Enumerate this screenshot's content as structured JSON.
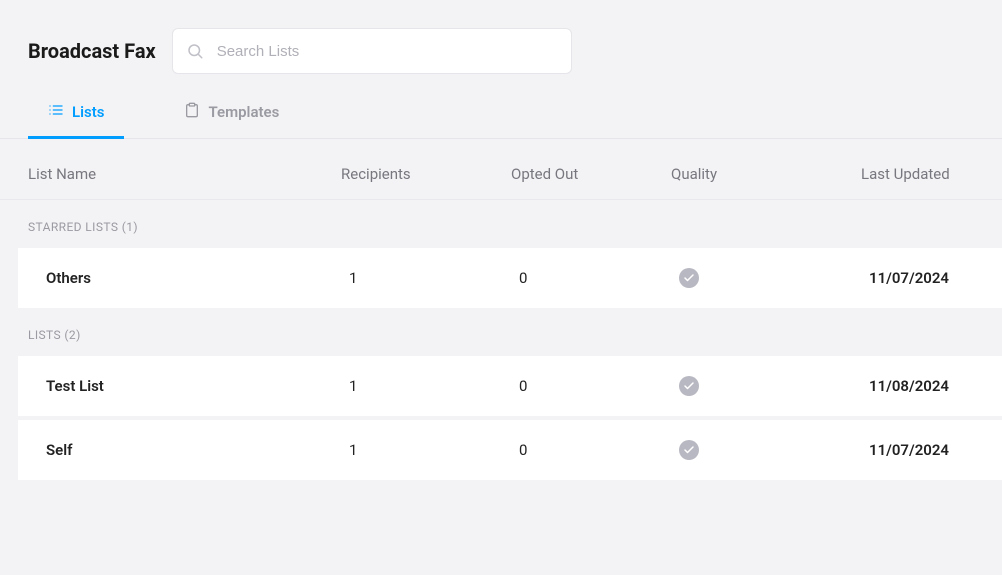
{
  "header": {
    "title": "Broadcast Fax",
    "search_placeholder": "Search Lists"
  },
  "tabs": {
    "lists": "Lists",
    "templates": "Templates"
  },
  "columns": {
    "name": "List Name",
    "recipients": "Recipients",
    "opted_out": "Opted Out",
    "quality": "Quality",
    "updated": "Last Updated"
  },
  "sections": {
    "starred_label": "STARRED LISTS (1)",
    "lists_label": "LISTS (2)"
  },
  "starred": [
    {
      "name": "Others",
      "recipients": "1",
      "opted_out": "0",
      "updated": "11/07/2024"
    }
  ],
  "lists": [
    {
      "name": "Test List",
      "recipients": "1",
      "opted_out": "0",
      "updated": "11/08/2024"
    },
    {
      "name": "Self",
      "recipients": "1",
      "opted_out": "0",
      "updated": "11/07/2024"
    }
  ]
}
